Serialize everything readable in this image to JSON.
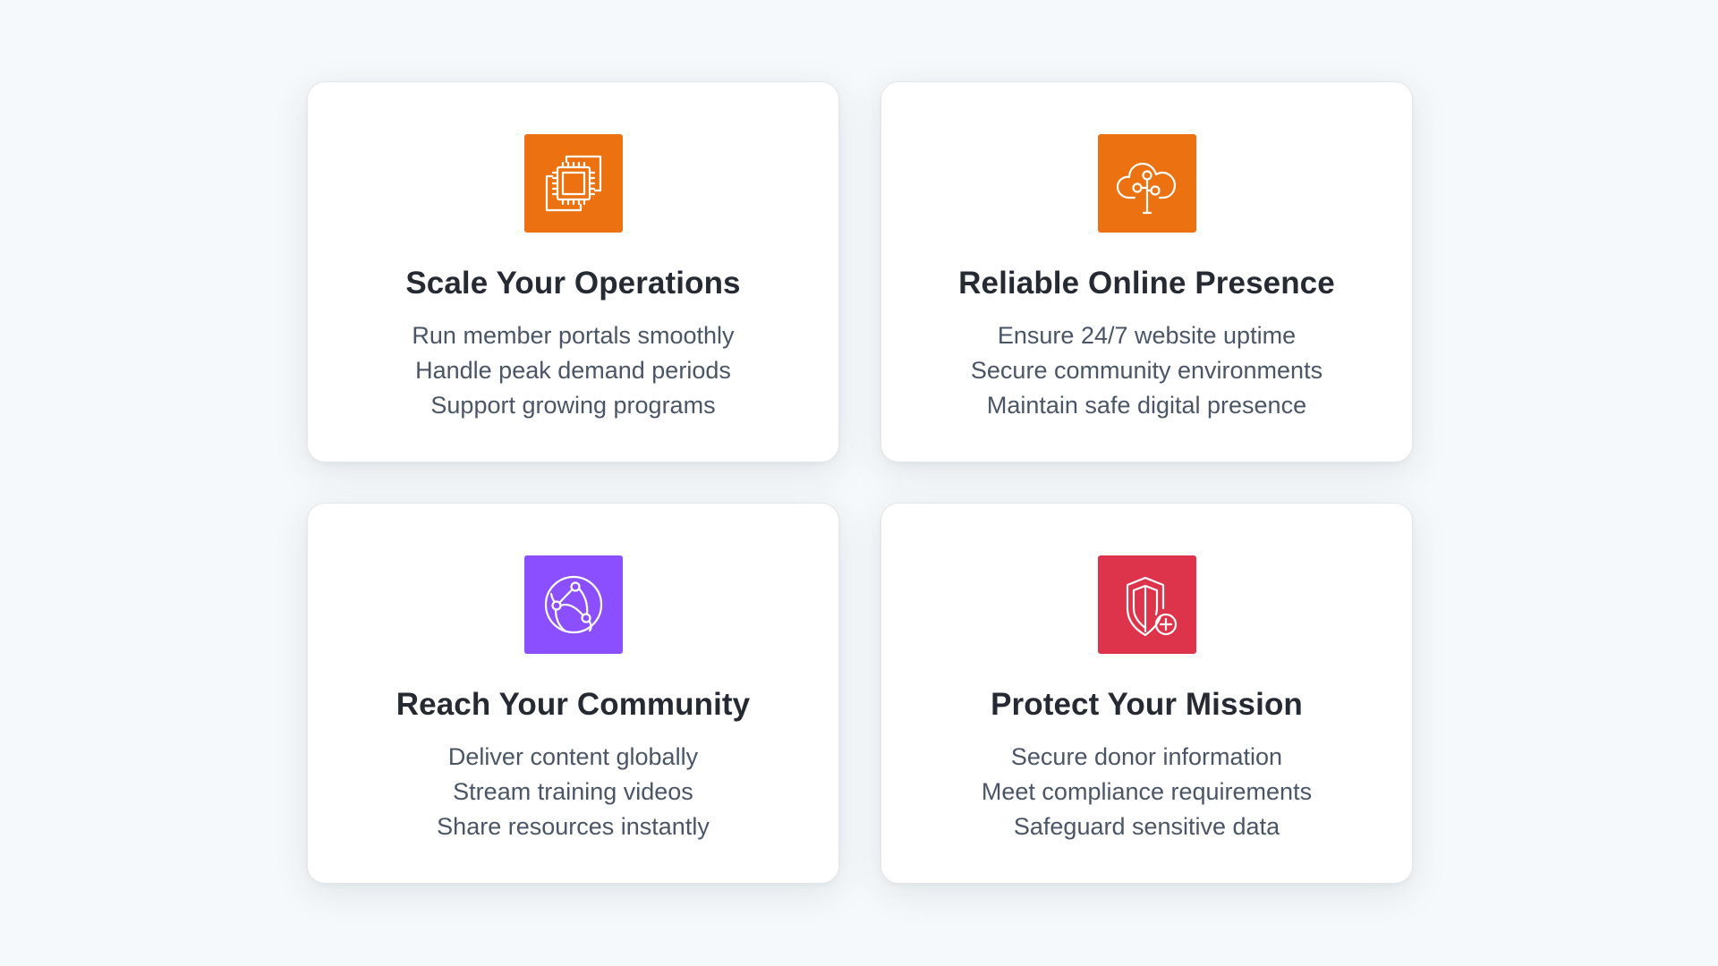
{
  "cards": [
    {
      "title": "Scale Your Operations",
      "icon": "compute-chip-icon",
      "color": "#ec7211",
      "lines": [
        "Run member portals smoothly",
        "Handle peak demand periods",
        "Support growing programs"
      ]
    },
    {
      "title": "Reliable Online Presence",
      "icon": "cloud-network-icon",
      "color": "#ec7211",
      "lines": [
        "Ensure 24/7 website uptime",
        "Secure community environments",
        "Maintain safe digital presence"
      ]
    },
    {
      "title": "Reach Your Community",
      "icon": "globe-network-icon",
      "color": "#8c4fff",
      "lines": [
        "Deliver content globally",
        "Stream training videos",
        "Share resources instantly"
      ]
    },
    {
      "title": "Protect Your Mission",
      "icon": "shield-plus-icon",
      "color": "#dd344c",
      "lines": [
        "Secure donor information",
        "Meet compliance requirements",
        "Safeguard sensitive data"
      ]
    }
  ]
}
